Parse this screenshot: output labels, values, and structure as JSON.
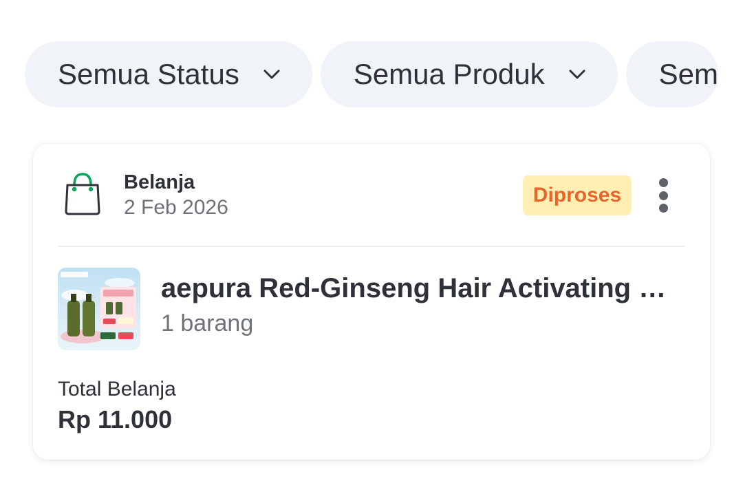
{
  "filters": {
    "status_label": "Semua Status",
    "product_label": "Semua Produk",
    "third_label_partial": "Sem"
  },
  "transaction": {
    "type": "Belanja",
    "date": "2 Feb 2026",
    "status": "Diproses",
    "status_colors": {
      "background": "#ffefb3",
      "text": "#e8652b"
    },
    "product": {
      "name": "aepura Red-Ginseng Hair Activating Serum",
      "quantity": "1 barang"
    },
    "total_label": "Total Belanja",
    "total_value": "Rp 11.000"
  },
  "icons": {
    "chip_chevron": "chevron-down-icon",
    "type_icon": "shopping-bag-icon",
    "more": "more-vertical-icon"
  }
}
